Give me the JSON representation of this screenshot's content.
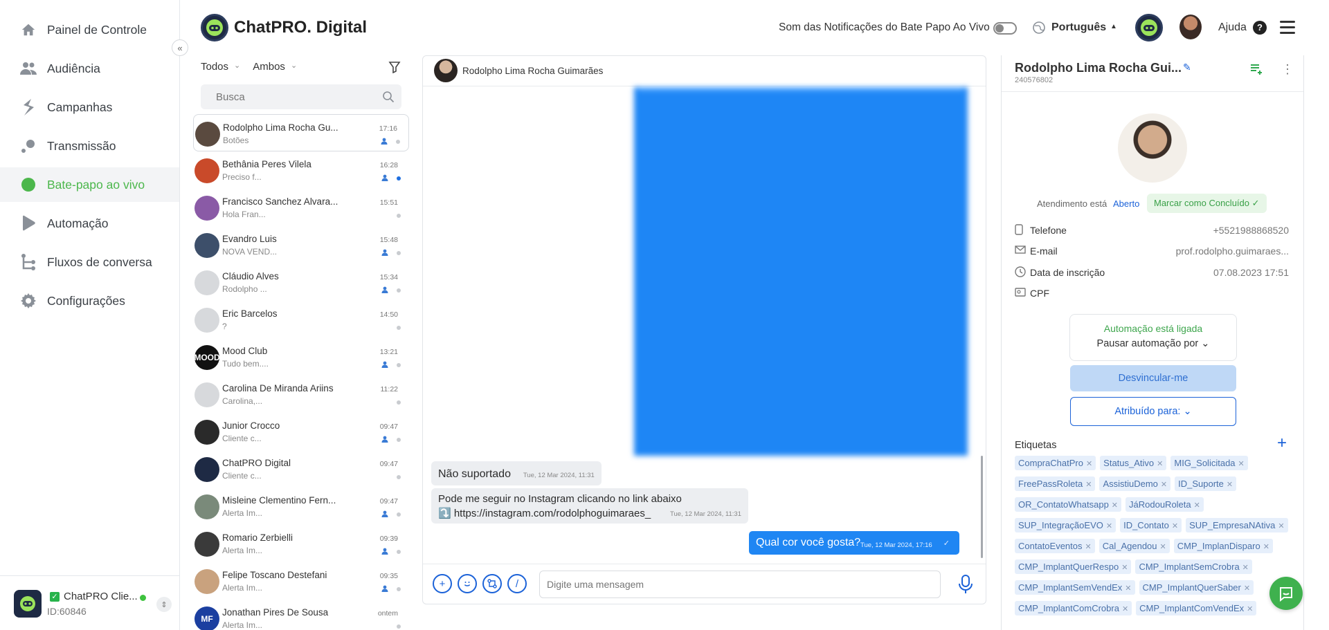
{
  "nav": {
    "items": [
      {
        "label": "Painel de Controle",
        "icon": "home-icon"
      },
      {
        "label": "Audiência",
        "icon": "users-icon"
      },
      {
        "label": "Campanhas",
        "icon": "campaign-icon"
      },
      {
        "label": "Transmissão",
        "icon": "broadcast-icon"
      },
      {
        "label": "Bate-papo ao vivo",
        "icon": "chat-bubble-icon",
        "active": true
      },
      {
        "label": "Automação",
        "icon": "play-icon"
      },
      {
        "label": "Fluxos de conversa",
        "icon": "flow-icon"
      },
      {
        "label": "Configurações",
        "icon": "gear-icon"
      }
    ],
    "collapse_glyph": "«",
    "account": {
      "name": "ChatPRO Clie...",
      "id": "ID:60846",
      "logo_text": "ChatPRO"
    }
  },
  "header": {
    "brand": "ChatPRO. Digital",
    "notif_label": "Som das Notificações do Bate Papo Ao Vivo",
    "language": "Português",
    "help": "Ajuda",
    "help_glyph": "?"
  },
  "list": {
    "filter_all": "Todos",
    "filter_both": "Ambos",
    "search_placeholder": "Busca",
    "conversations": [
      {
        "name": "Rodolpho Lima Rocha Gu...",
        "preview": "Botões",
        "time": "17:16",
        "person": true,
        "dot": "gray",
        "avatar": "#5a4a3f",
        "active": true
      },
      {
        "name": "Bethânia Peres Vilela",
        "preview": "Preciso f...",
        "time": "16:28",
        "person": true,
        "dot": "blue",
        "avatar": "#c94a2a"
      },
      {
        "name": "Francisco Sanchez Alvara...",
        "preview": "Hola Fran...",
        "time": "15:51",
        "person": false,
        "dot": "gray",
        "avatar": "#8a5aa6"
      },
      {
        "name": "Evandro Luis",
        "preview": "NOVA VEND...",
        "time": "15:48",
        "person": true,
        "dot": "gray",
        "avatar": "#3d4f6a"
      },
      {
        "name": "Cláudio Alves",
        "preview": "Rodolpho ...",
        "time": "15:34",
        "person": true,
        "dot": "gray",
        "avatar": "#d7d9dc"
      },
      {
        "name": "Eric Barcelos",
        "preview": "?",
        "time": "14:50",
        "person": false,
        "dot": "gray",
        "avatar": "#d7d9dc"
      },
      {
        "name": "Mood Club",
        "preview": "Tudo bem....",
        "time": "13:21",
        "person": true,
        "dot": "gray",
        "avatar": "#111111",
        "avatar_text": "MOOD"
      },
      {
        "name": "Carolina De Miranda Ariins",
        "preview": "Carolina,...",
        "time": "11:22",
        "person": false,
        "dot": "gray",
        "avatar": "#d7d9dc"
      },
      {
        "name": "Junior Crocco",
        "preview": "Cliente c...",
        "time": "09:47",
        "person": true,
        "dot": "gray",
        "avatar": "#2a2a2a"
      },
      {
        "name": "ChatPRO Digital",
        "preview": "Cliente c...",
        "time": "09:47",
        "person": false,
        "dot": "gray",
        "avatar": "#1e2a44"
      },
      {
        "name": "Misleine Clementino Fern...",
        "preview": "Alerta Im...",
        "time": "09:47",
        "person": true,
        "dot": "gray",
        "avatar": "#7a8a7a"
      },
      {
        "name": "Romario Zerbielli",
        "preview": "Alerta Im...",
        "time": "09:39",
        "person": true,
        "dot": "gray",
        "avatar": "#3a3a3a"
      },
      {
        "name": "Felipe Toscano Destefani",
        "preview": "Alerta Im...",
        "time": "09:35",
        "person": true,
        "dot": "gray",
        "avatar": "#c9a27e"
      },
      {
        "name": "Jonathan Pires De Sousa",
        "preview": "Alerta Im...",
        "time": "ontem",
        "person": false,
        "dot": "gray",
        "avatar": "#1b3fa0",
        "avatar_text": "MF"
      }
    ]
  },
  "chat": {
    "contact_name": "Rodolpho Lima Rocha Guimarães",
    "msg_unsupported": "Não suportado",
    "msg_unsupported_time": "Tue, 12 Mar 2024, 11:31",
    "msg_ig_line1": "Pode me seguir no Instagram clicando no link abaixo",
    "msg_ig_line2": "⤵️ https://instagram.com/rodolphoguimaraes_",
    "msg_ig_time": "Tue, 12 Mar 2024, 11:31",
    "msg_out": "Qual cor você gosta?",
    "msg_out_time": "Tue, 12 Mar 2024, 17:16",
    "composer_placeholder": "Digite uma mensagem"
  },
  "details": {
    "name": "Rodolpho Lima Rocha Gui...",
    "id": "240576802",
    "attendance_label": "Atendimento está",
    "attendance_status": "Aberto",
    "mark_done": "Marcar como Concluído ✓",
    "phone_label": "Telefone",
    "phone": "+5521988868520",
    "email_label": "E-mail",
    "email": "prof.rodolpho.guimaraes...",
    "signup_label": "Data de inscrição",
    "signup": "07.08.2023 17:51",
    "cpf_label": "CPF",
    "automation_on": "Automação está ligada",
    "pause_automation": "Pausar automação por ⌄",
    "unlink": "Desvincular-me",
    "assigned": "Atribuído para: ⌄",
    "tags_label": "Etiquetas",
    "tags": [
      "CompraChatPro",
      "Status_Ativo",
      "MIG_Solicitada",
      "FreePassRoleta",
      "AssistiuDemo",
      "ID_Suporte",
      "OR_ContatoWhatsapp",
      "JáRodouRoleta",
      "SUP_IntegraçãoEVO",
      "ID_Contato",
      "SUP_EmpresaNAtiva",
      "ContatoEventos",
      "Cal_Agendou",
      "CMP_ImplanDisparo",
      "CMP_ImplantQuerRespo",
      "CMP_ImplantSemCrobra",
      "CMP_ImplantSemVendEx",
      "CMP_ImplantQuerSaber",
      "CMP_ImplantComCrobra",
      "CMP_ImplantComVendEx"
    ]
  },
  "colors": {
    "accent": "#4cb74c",
    "primary": "#1b62d8",
    "bubble_out": "#1f86f3"
  }
}
